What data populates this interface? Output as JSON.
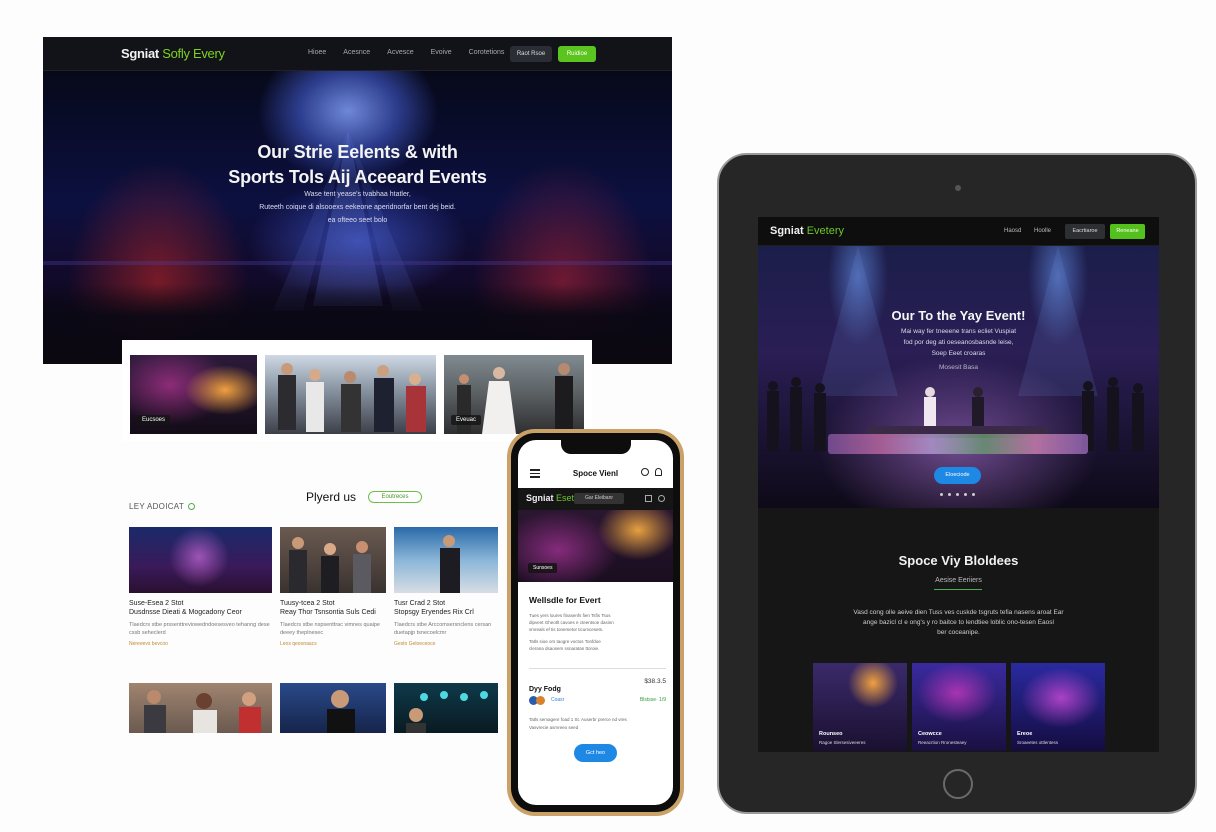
{
  "desktop": {
    "logo_main": "Sgniat",
    "logo_accent": "Sofly Every",
    "nav_links": [
      "Hioee",
      "Acesnce",
      "Acvesce",
      "Evoive",
      "Corotetions"
    ],
    "btn_dark": "Raot Rsoe",
    "btn_green": "Ruidioe",
    "hero_line1": "Our Strie Eelents & with",
    "hero_line2": "Sports Tols Aij Aceeard Events",
    "hero_sub1": "Wase tent yease's tvabhaa htatler,",
    "hero_sub2": "Ruteeth coique di alsooexs eekeone aperidnorfar bent dej beid.",
    "hero_sub3": "ea ofteeo seet bolo",
    "gallery": [
      {
        "tag": "Eucsoes"
      },
      {
        "tag": ""
      },
      {
        "tag": "Eveuac"
      }
    ],
    "blog_label": "LEY ADOICAT",
    "blog_title": "Plyerd us",
    "blog_chip": "Eoutreces",
    "posts": [
      {
        "title1": "Suse-Esea 2 Stot",
        "title2": "Dusdnsse Dieati & Mogcadony Ceor",
        "excerpt": "Tlaedcrs stbe prssenttreviowedndoesesveo tehanng dese cssb seheclerd",
        "meta": "Nereeevs bevcoo"
      },
      {
        "title1": "Tuusy-tcea 2 Stot",
        "title2": "Reay Thor Tsnsontia Suls Cedi",
        "excerpt": "Tlaedcrs stbe nspsenttrac vimnes quaipe deeey theplnesec",
        "meta": "Leos qeoonaacs"
      },
      {
        "title1": "Tusr Crad 2 Stot",
        "title2": "Stopsgy Eryendes Rix Crl",
        "excerpt": "Tlaedcrs stbe Arccomsersnclens cersan duetapjp tsnecoelcmr",
        "meta": "Gesto Geloeceoce"
      }
    ]
  },
  "phone": {
    "title": "Spoce Vienl",
    "logo_main": "Sgniat",
    "logo_accent": "Eset",
    "pill": "Gar Eleibanr",
    "hero_tag": "Sunsoes",
    "heading": "Wellsdle for Evert",
    "para1": "Tues yers loures finasenfs fien Tsfis Tsos",
    "para2": "dipvent Gheotlt cavoes e cteentsoe dasinn",
    "para3": "smreals ef tis tonemetor ticumcesets.",
    "para4": "Tatls sioe ors taogre voctos Tonfdoe",
    "para5": "clerana dsaosem ssnaratan ttoroie.",
    "row_label": "Dyy Fodg",
    "row_value": "$38.3.5",
    "avatar_name": "Coasr",
    "avatar_right": "Blstsse· 1/9",
    "para6": "Tatls semagenr foad 1 St. Auserbr prerce nd vres",
    "para7": "Vasvrecie asrvreeo seed",
    "cta": "Gct heo"
  },
  "tablet": {
    "logo_main": "Sgniat",
    "logo_accent": "Evetery",
    "links": [
      "Haosd",
      "Hoolle"
    ],
    "btn_dark": "Eacrtiaroe",
    "btn_green": "Reneane",
    "hero_title": "Our To the Yay Event!",
    "hero_sub1": "Mai way fer tneeene trans ecliet Vuspiat",
    "hero_sub2": "fod por deg ati oeseanosbasnde leise,",
    "hero_sub3": "Soep Eeet croaras",
    "hero_sub4": "Mosesit Basa",
    "cta": "Eloeciode",
    "section_title": "Spoce Viy Bloldees",
    "section_sub": "Aesise Eeriiers",
    "para1": "Vasd cong olle aeive dien Tuss ves cuskde tsgruts tefia nasens aroat Ear",
    "para2": "ange bazicl cl e ong's y ro baitce to lendtiee loblic ono-tesen Eaosl",
    "para3": "ber coceanipe.",
    "cards": [
      {
        "title": "Rounseo",
        "sub": "Ragoe Slersesiveeeres"
      },
      {
        "title": "Ceowcce",
        "sub": "Reeacrtion Rronesteaey"
      },
      {
        "title": "Ereoe",
        "sub": "Sroaeetes ottlentess"
      }
    ]
  }
}
